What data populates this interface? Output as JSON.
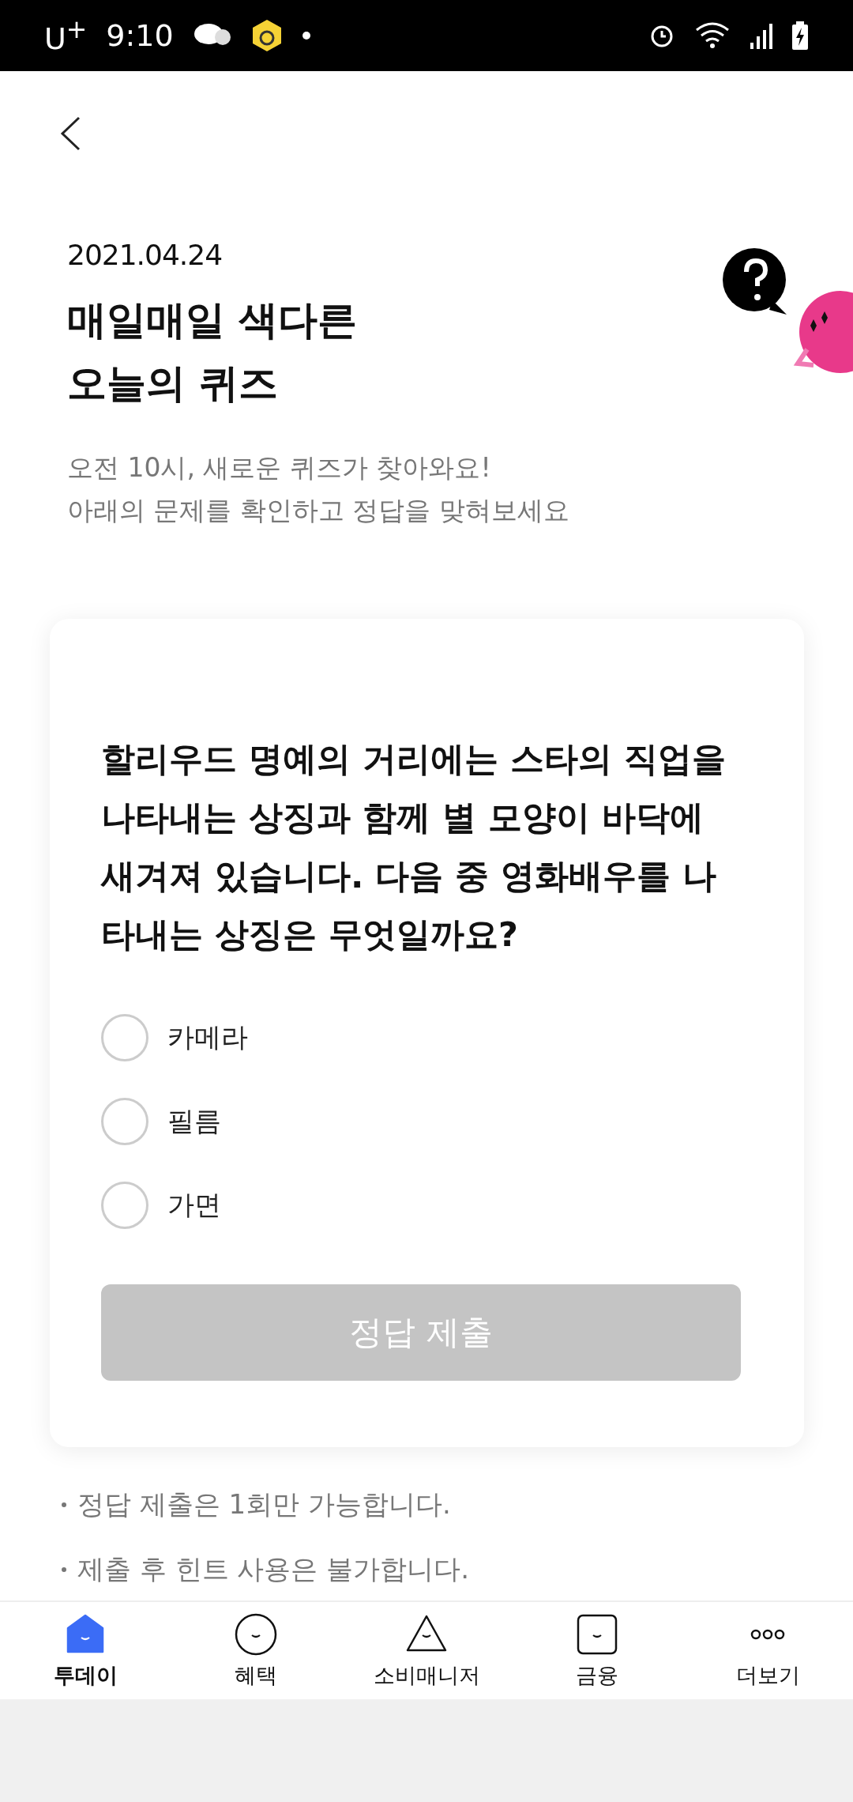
{
  "status_bar": {
    "carrier": "U$^{+}$",
    "time": "9:10"
  },
  "header": {
    "date": "2021.04.24",
    "title_lines": [
      "매일매일 색다른",
      "오늘의 퀴즈"
    ],
    "subtitle_lines": [
      "오전 10시, 새로운 퀴즈가 찾아와요!",
      "아래의 문제를 확인하고 정답을 맞혀보세요"
    ]
  },
  "quiz": {
    "question": "할리우드 명예의 거리에는 스타의 직업을 나타내는 상징과 함께 별 모양이 바닥에 새겨져 있습니다. 다음 중 영화배우를 나타내는 상징은 무엇일까요?",
    "options": [
      {
        "label": "카메라",
        "selected": false
      },
      {
        "label": "필름",
        "selected": false
      },
      {
        "label": "가면",
        "selected": false
      }
    ],
    "submit": {
      "label": "정답 제출",
      "disabled": true
    }
  },
  "notes": [
    "정답 제출은 1회만 가능합니다.",
    "제출 후 힌트 사용은 불가합니다."
  ],
  "tab_bar": [
    {
      "kind": "house",
      "label": "투데이",
      "selected": true
    },
    {
      "kind": "circle",
      "label": "혜택",
      "selected": false
    },
    {
      "kind": "triangle",
      "label": "소비매니저",
      "selected": false
    },
    {
      "kind": "square",
      "label": "금융",
      "selected": false
    },
    {
      "kind": "dots",
      "label": "더보기",
      "selected": false
    }
  ]
}
